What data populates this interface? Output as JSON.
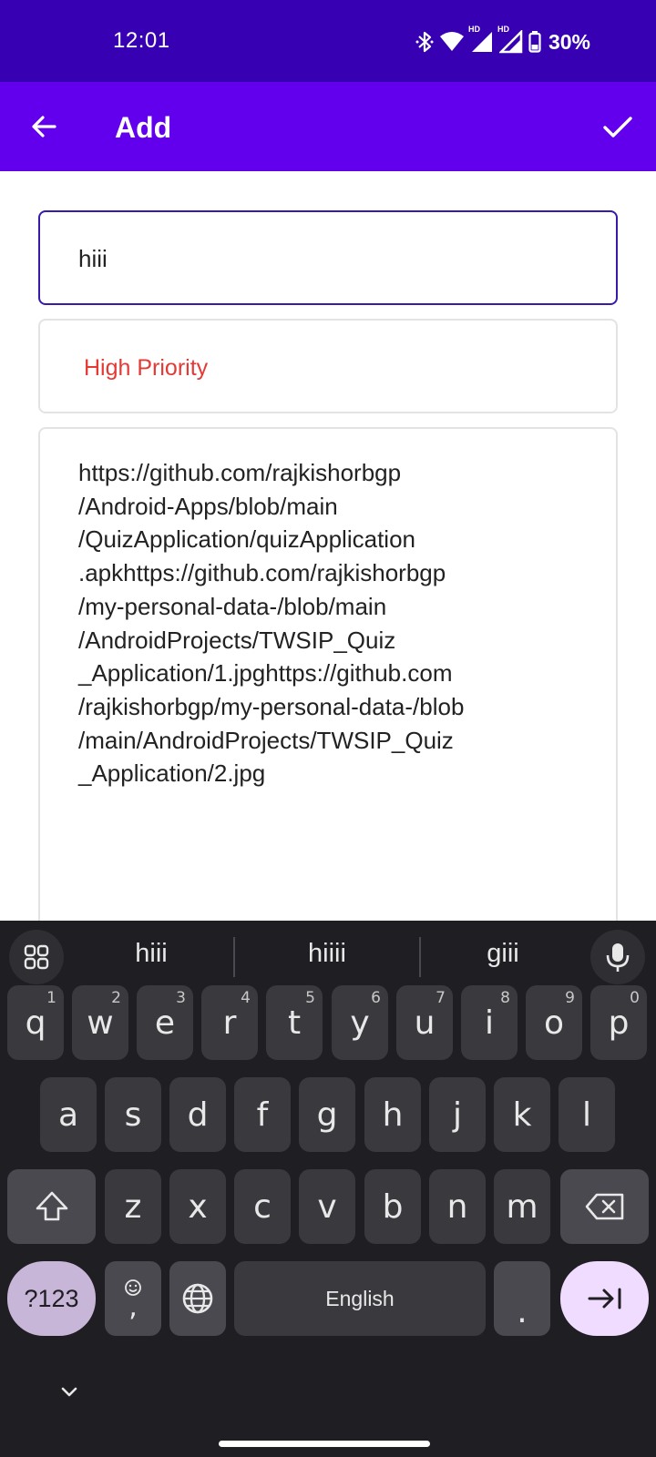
{
  "status_bar": {
    "time": "12:01",
    "battery": "30%",
    "hd1": "HD",
    "hd2": "HD"
  },
  "app_bar": {
    "title": "Add"
  },
  "form": {
    "title_value": "hiii",
    "priority_value": "High Priority",
    "description_lines": [
      "https://github.com/rajkishorbgp",
      "/Android-Apps/blob/main",
      "/QuizApplication/quizApplication",
      ".apkhttps://github.com/rajkishorbgp",
      "/my-personal-data-/blob/main",
      "/AndroidProjects/TWSIP_Quiz",
      "_Application/1.jpghttps://github.com",
      "/rajkishorbgp/my-personal-data-/blob",
      "/main/AndroidProjects/TWSIP_Quiz",
      "_Application/2.jpg"
    ]
  },
  "keyboard": {
    "suggestions": [
      "hiii",
      "hiiii",
      "giii"
    ],
    "row1": [
      {
        "k": "q",
        "h": "1"
      },
      {
        "k": "w",
        "h": "2"
      },
      {
        "k": "e",
        "h": "3"
      },
      {
        "k": "r",
        "h": "4"
      },
      {
        "k": "t",
        "h": "5"
      },
      {
        "k": "y",
        "h": "6"
      },
      {
        "k": "u",
        "h": "7"
      },
      {
        "k": "i",
        "h": "8"
      },
      {
        "k": "o",
        "h": "9"
      },
      {
        "k": "p",
        "h": "0"
      }
    ],
    "row2": [
      "a",
      "s",
      "d",
      "f",
      "g",
      "h",
      "j",
      "k",
      "l"
    ],
    "row3": [
      "z",
      "x",
      "c",
      "v",
      "b",
      "n",
      "m"
    ],
    "sym_label": "?123",
    "comma_label": ",",
    "space_label": "English",
    "period_label": ".",
    "accent_color": "#f0dcff"
  }
}
